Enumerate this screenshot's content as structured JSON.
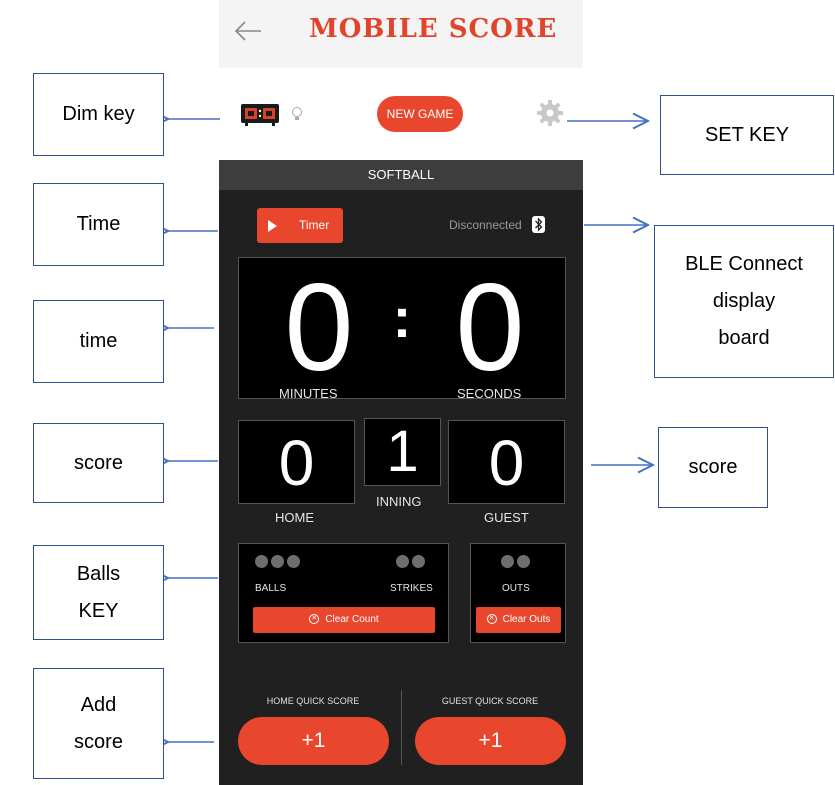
{
  "header": {
    "title": "MOBILE SCORE"
  },
  "toolbar": {
    "new_game_label": "NEW GAME"
  },
  "board": {
    "sport": "SOFTBALL",
    "timer_label": "Timer",
    "connection_status": "Disconnected",
    "minutes": "0",
    "seconds": "0",
    "minutes_label": "MINUTES",
    "seconds_label": "SECONDS",
    "home_score": "0",
    "inning": "1",
    "guest_score": "0",
    "home_label": "HOME",
    "inning_label": "INNING",
    "guest_label": "GUEST",
    "balls_label": "BALLS",
    "strikes_label": "STRIKES",
    "outs_label": "OUTS",
    "balls_count": 0,
    "strikes_count": 0,
    "outs_count": 0,
    "clear_count_label": "Clear Count",
    "clear_outs_label": "Clear Outs",
    "home_quick_label": "HOME QUICK SCORE",
    "guest_quick_label": "GUEST QUICK SCORE",
    "home_quick_btn": "+1",
    "guest_quick_btn": "+1"
  },
  "annotations": {
    "dim_key": "Dim key",
    "set_key": "SET KEY",
    "time_btn": "Time",
    "time_display": "time",
    "ble_line1": "BLE Connect",
    "ble_line2": "display",
    "ble_line3": "board",
    "score_left": "score",
    "score_right": "score",
    "balls_line1": "Balls",
    "balls_line2": "KEY",
    "add_line1": "Add",
    "add_line2": "score"
  },
  "colors": {
    "accent": "#e9472d",
    "board_bg": "#202020",
    "callout_border": "#2f4f8f",
    "arrow": "#4472c4"
  }
}
